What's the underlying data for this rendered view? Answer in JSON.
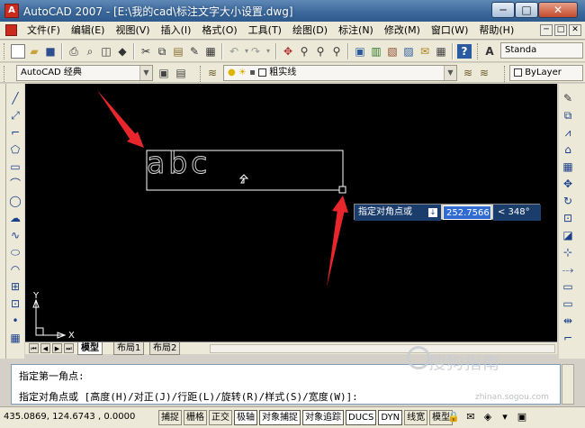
{
  "window": {
    "title": "AutoCAD 2007 - [E:\\我的cad\\标注文字大小设置.dwg]",
    "controls": {
      "minimize": "─",
      "maximize": "□",
      "close": "✕"
    }
  },
  "menu": {
    "items": [
      "文件(F)",
      "编辑(E)",
      "视图(V)",
      "插入(I)",
      "格式(O)",
      "工具(T)",
      "绘图(D)",
      "标注(N)",
      "修改(M)",
      "窗口(W)",
      "帮助(H)"
    ],
    "doc_controls": [
      "─",
      "□",
      "✕"
    ]
  },
  "toolbar": {
    "text_style": "Standa",
    "workspace": "AutoCAD 经典",
    "layer": "粗实线",
    "bylayer": "ByLayer"
  },
  "drawing": {
    "text": "abc",
    "axis_y": "Y",
    "axis_x": "X"
  },
  "prompt": {
    "label": "指定对角点或",
    "value": "252.7566",
    "angle": "< 348°"
  },
  "tabs": {
    "nav": [
      "⏮",
      "◀",
      "▶",
      "⏭"
    ],
    "items": [
      "模型",
      "布局1",
      "布局2"
    ],
    "active": 0
  },
  "command": {
    "line1": "指定第一角点:",
    "line2": "指定对角点或 [高度(H)/对正(J)/行距(L)/旋转(R)/样式(S)/宽度(W)]:"
  },
  "status": {
    "coords": "435.0869, 124.6743 , 0.0000",
    "modes": [
      "捕捉",
      "栅格",
      "正交",
      "极轴",
      "对象捕捉",
      "对象追踪",
      "DUCS",
      "DYN",
      "线宽",
      "模型"
    ],
    "modes_on": [
      false,
      false,
      false,
      true,
      true,
      true,
      true,
      true,
      false,
      false
    ]
  },
  "watermark": {
    "text": "搜狗指南",
    "url": "zhinan.sogou.com"
  },
  "colors": {
    "canvas": "#000000",
    "annotation_arrow": "#e8262b",
    "titlebar": "#3d6a9d",
    "prompt_bg": "#1b3d6b",
    "prompt_value": "#2f6bd0"
  }
}
